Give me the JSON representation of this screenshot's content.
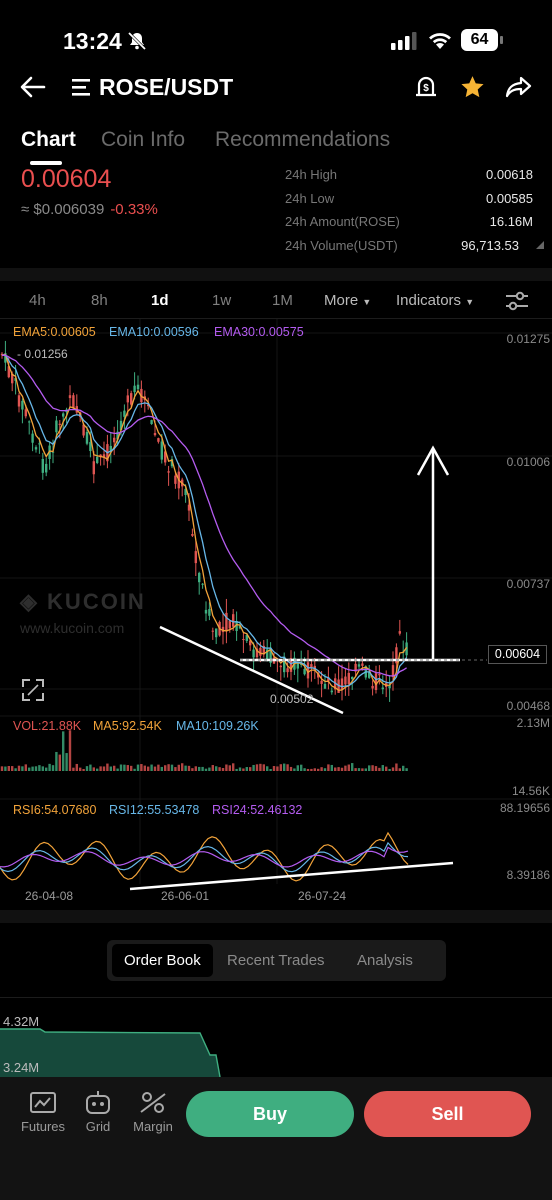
{
  "status": {
    "time": "13:24",
    "battery": "64"
  },
  "header": {
    "pair": "ROSE/USDT"
  },
  "tabs": [
    "Chart",
    "Coin Info",
    "Recommendations"
  ],
  "price": {
    "last": "0.00604",
    "fiat": "≈ $0.006039",
    "change": "-0.33%"
  },
  "stats": [
    {
      "label": "24h High",
      "value": "0.00618"
    },
    {
      "label": "24h Low",
      "value": "0.00585"
    },
    {
      "label": "24h Amount(ROSE)",
      "value": "16.16M"
    },
    {
      "label": "24h Volume(USDT)",
      "value": "96,713.53"
    }
  ],
  "timeframes": [
    "4h",
    "8h",
    "1d",
    "1w",
    "1M"
  ],
  "timeframe_active": "1d",
  "more_label": "More",
  "indicators_label": "Indicators",
  "ema": {
    "ema5": "EMA5:0.00605",
    "ema10": "EMA10:0.00596",
    "ema30": "EMA30:0.00575"
  },
  "price_axis": [
    "0.01275",
    "0.01006",
    "0.00737",
    "0.00604",
    "0.00468"
  ],
  "annot": {
    "high": "0.01256",
    "low": "0.00502"
  },
  "watermark": {
    "brand": "KUCOIN",
    "url": "www.kucoin.com"
  },
  "volume": {
    "vol": "VOL:21.88K",
    "ma5": "MA5:92.54K",
    "ma10": "MA10:109.26K",
    "axis_top": "2.13M",
    "axis_bottom": "14.56K"
  },
  "rsi": {
    "rsi6": "RSI6:54.07680",
    "rsi12": "RSI12:55.53478",
    "rsi24": "RSI24:52.46132",
    "axis_top": "88.19656",
    "axis_bottom": "8.39186"
  },
  "dates": [
    "26-04-08",
    "26-06-01",
    "26-07-24"
  ],
  "orderbook": {
    "tabs": [
      "Order Book",
      "Recent Trades",
      "Analysis"
    ],
    "depth": [
      "4.32M",
      "3.24M"
    ]
  },
  "bottom_nav": [
    "Futures",
    "Grid",
    "Margin"
  ],
  "actions": {
    "buy": "Buy",
    "sell": "Sell"
  },
  "colors": {
    "up": "#3fae80",
    "down": "#e05552",
    "ema5": "#f2a33a",
    "ema10": "#67b7e8",
    "ema30": "#b45cf0"
  }
}
